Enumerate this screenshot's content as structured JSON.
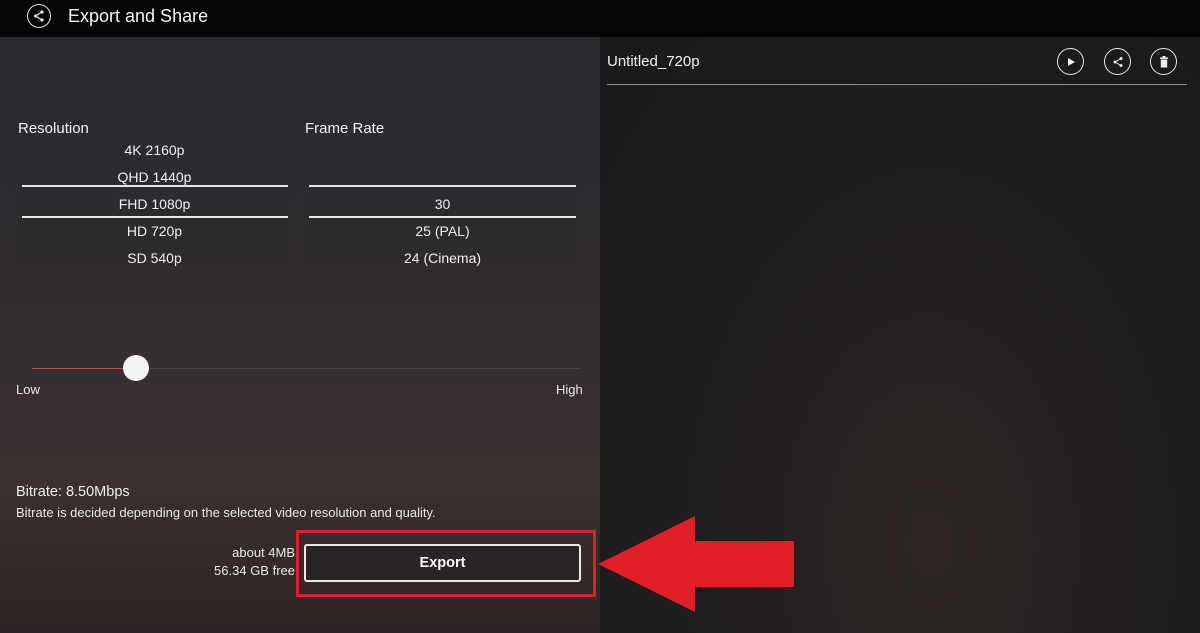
{
  "header": {
    "title": "Export and Share",
    "back_icon": "back-share-icon"
  },
  "settings": {
    "resolution": {
      "label": "Resolution",
      "options": [
        "4K 2160p",
        "QHD 1440p",
        "FHD 1080p",
        "HD 720p",
        "SD 540p"
      ],
      "selected": "FHD 1080p"
    },
    "frame_rate": {
      "label": "Frame Rate",
      "options": [
        "",
        "30",
        "25 (PAL)",
        "24 (Cinema)"
      ],
      "selected": "30"
    },
    "quality": {
      "low_label": "Low",
      "high_label": "High",
      "value": 0.19
    },
    "bitrate_label": "Bitrate: 8.50Mbps",
    "bitrate_note": "Bitrate is decided depending on the selected video resolution and quality.",
    "file_size": "about 4MB",
    "free_space": "56.34 GB free",
    "export_label": "Export"
  },
  "preview": {
    "project_name": "Untitled_720p",
    "actions": [
      "play-icon",
      "share-icon",
      "delete-icon"
    ]
  },
  "annotation": {
    "highlight_color": "#e01f26",
    "arrow_color": "#e01f26"
  }
}
